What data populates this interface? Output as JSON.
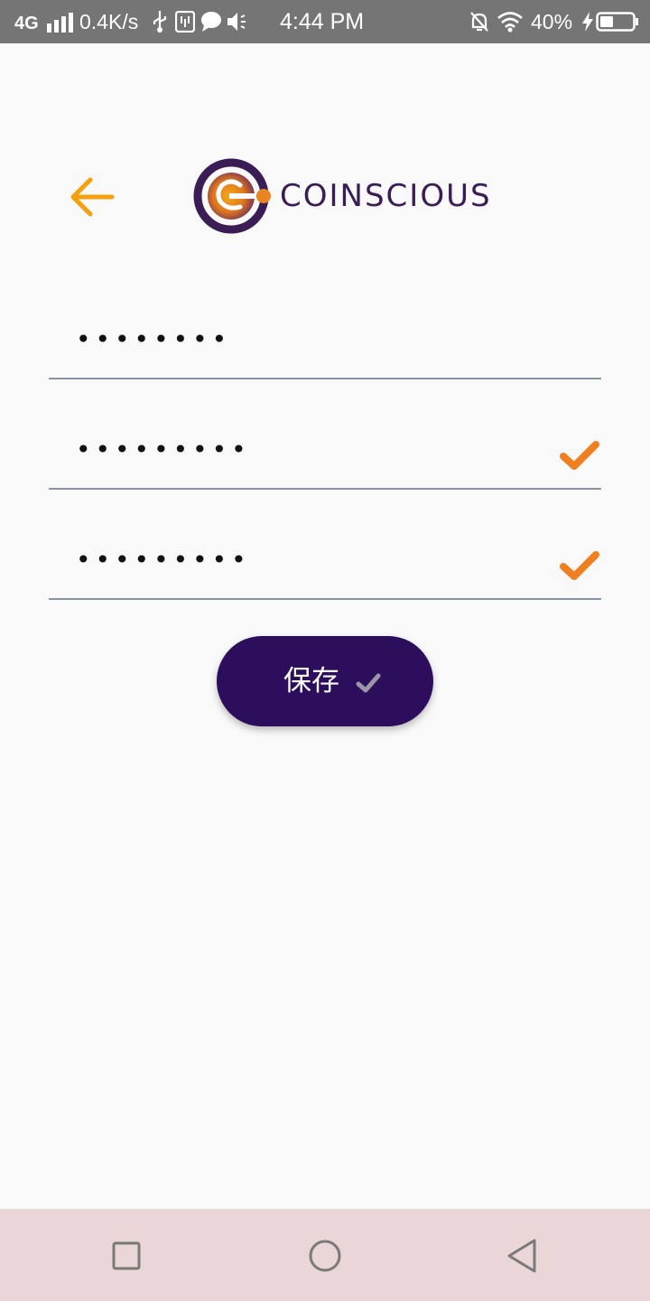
{
  "status_bar": {
    "network": "4G",
    "speed": "0.4K/s",
    "time": "4:44 PM",
    "battery": "40%",
    "icons": [
      "signal-icon",
      "usb-icon",
      "usb-debug-icon",
      "chat-icon",
      "volume-icon",
      "silent-bell-icon",
      "wifi-icon",
      "charging-icon",
      "battery-icon"
    ]
  },
  "header": {
    "back_icon": "arrow-left-icon",
    "logo_text": "COINSCIOUS"
  },
  "fields": [
    {
      "value": "••••••••",
      "validated": false
    },
    {
      "value": "•••••••••",
      "validated": true
    },
    {
      "value": "•••••••••",
      "validated": true
    }
  ],
  "save_button": {
    "label": "保存",
    "icon": "check-icon"
  },
  "nav_bar": {
    "icons": [
      "recent-apps-icon",
      "home-icon",
      "back-icon"
    ]
  },
  "colors": {
    "accent": "#f0801f",
    "back_arrow": "#f5a00e",
    "primary": "#2d0e5c",
    "status_bar": "#757575",
    "nav_bar": "#ead5d7",
    "divider": "#8a93a3"
  }
}
